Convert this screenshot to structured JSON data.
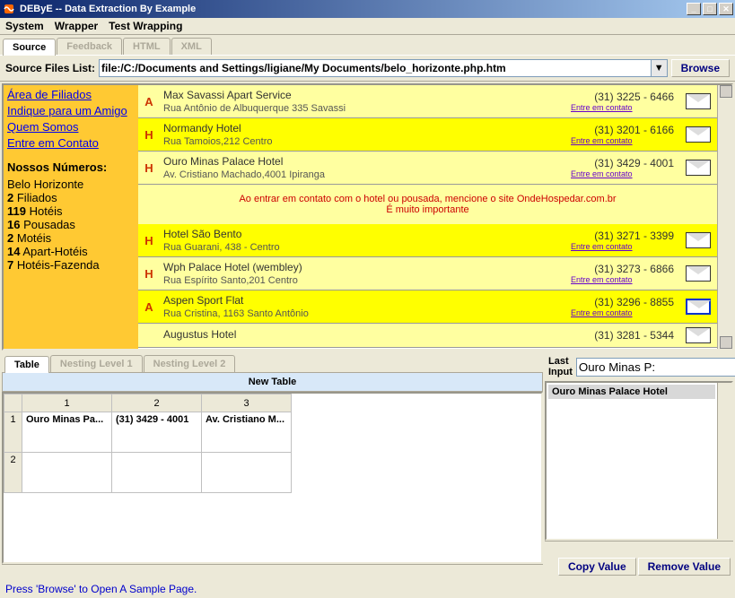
{
  "window": {
    "title": "DEByE -- Data Extraction By Example"
  },
  "menu": {
    "items": [
      "System",
      "Wrapper",
      "Test Wrapping"
    ]
  },
  "main_tabs": {
    "items": [
      "Source",
      "Feedback",
      "HTML",
      "XML"
    ],
    "active": 0
  },
  "toolbar": {
    "label": "Source Files List:",
    "path": "file:/C:/Documents and Settings/ligiane/My Documents/belo_horizonte.php.htm",
    "browse": "Browse"
  },
  "sidebar": {
    "links": [
      "Área de Filiados",
      "Indique para um Amigo",
      "Quem Somos",
      "Entre em Contato"
    ],
    "stats_title": "Nossos Números:",
    "stats_sub": "Belo Horizonte",
    "stats": [
      {
        "n": "2",
        "l": "Filiados"
      },
      {
        "n": "119",
        "l": "Hotéis"
      },
      {
        "n": "16",
        "l": "Pousadas"
      },
      {
        "n": "2",
        "l": "Motéis"
      },
      {
        "n": "14",
        "l": "Apart-Hotéis"
      },
      {
        "n": "7",
        "l": "Hotéis-Fazenda"
      }
    ]
  },
  "listings": [
    {
      "t": "A",
      "bg": "a",
      "name": "Max Savassi Apart Service",
      "desc": "Rua Antônio de Albuquerque 335 Savassi",
      "phone": "(31) 3225 - 6466",
      "contact": "Entre em contato",
      "star": false
    },
    {
      "t": "H",
      "bg": "h",
      "name": "Normandy Hotel",
      "desc": "Rua Tamoios,212 Centro",
      "phone": "(31) 3201 - 6166",
      "contact": "Entre em contato",
      "star": false
    },
    {
      "t": "H",
      "bg": "a",
      "name": "Ouro Minas Palace Hotel",
      "desc": "Av. Cristiano Machado,4001 Ipiranga",
      "phone": "(31) 3429 - 4001",
      "contact": "Entre em contato",
      "star": false
    },
    {
      "t": "H",
      "bg": "h",
      "name": "Hotel São Bento",
      "desc": "Rua Guarani, 438 - Centro",
      "phone": "(31) 3271 - 3399",
      "contact": "Entre em contato",
      "star": false
    },
    {
      "t": "H",
      "bg": "a",
      "name": "Wph Palace Hotel (wembley)",
      "desc": "Rua Espírito Santo,201 Centro",
      "phone": "(31) 3273 - 6866",
      "contact": "Entre em contato",
      "star": false
    },
    {
      "t": "A",
      "bg": "h",
      "name": "Aspen Sport Flat",
      "desc": "Rua Cristina, 1163 Santo Antônio",
      "phone": "(31) 3296 - 8855",
      "contact": "Entre em contato",
      "star": true
    },
    {
      "t": "",
      "bg": "a",
      "name": "Augustus Hotel",
      "desc": "",
      "phone": "(31) 3281 - 5344",
      "contact": "",
      "star": false
    }
  ],
  "notice": {
    "line1": "Ao entrar em contato com o hotel ou pousada, mencione o site OndeHospedar.com.br",
    "line2": "É muito importante"
  },
  "bottom_tabs": {
    "items": [
      "Table",
      "Nesting Level 1",
      "Nesting Level 2"
    ],
    "active": 0
  },
  "new_table": "New Table",
  "grid": {
    "cols": [
      "1",
      "2",
      "3"
    ],
    "rows": [
      [
        "Ouro Minas Pa...",
        "(31) 3429 - 4001",
        "Av. Cristiano M..."
      ],
      [
        "",
        "",
        ""
      ]
    ]
  },
  "right": {
    "last_input_label": "Last Input",
    "last_input_value": "Ouro Minas P:",
    "detail": "Ouro Minas Palace Hotel",
    "copy": "Copy Value",
    "remove": "Remove Value"
  },
  "status": "Press 'Browse' to Open A Sample Page."
}
